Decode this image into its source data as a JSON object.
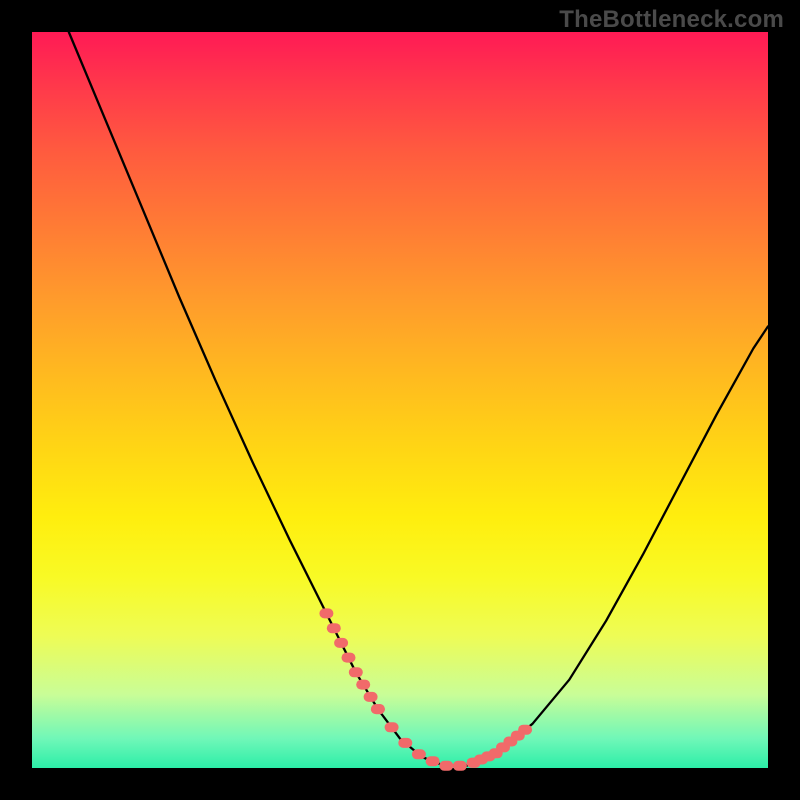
{
  "watermark": "TheBottleneck.com",
  "chart_data": {
    "type": "line",
    "title": "",
    "xlabel": "",
    "ylabel": "",
    "xlim": [
      0,
      100
    ],
    "ylim": [
      0,
      100
    ],
    "grid": false,
    "series": [
      {
        "name": "curve",
        "x": [
          5,
          10,
          15,
          20,
          25,
          30,
          35,
          40,
          44,
          47,
          50,
          53,
          56,
          59,
          63,
          68,
          73,
          78,
          83,
          88,
          93,
          98,
          100
        ],
        "y": [
          100,
          88,
          76,
          64,
          52.5,
          41.5,
          31,
          21,
          13,
          8,
          4,
          1.5,
          0.3,
          0.3,
          2,
          6,
          12,
          20,
          29,
          38.5,
          48,
          57,
          60
        ]
      }
    ],
    "paint_bands": [
      {
        "name": "left-band",
        "x_range": [
          40,
          47
        ],
        "y_range": [
          5,
          22
        ],
        "color": "#f16a6a"
      },
      {
        "name": "floor-band",
        "x_range": [
          47,
          60
        ],
        "y_range": [
          0.3,
          4
        ],
        "color": "#f16a6a"
      },
      {
        "name": "right-band",
        "x_range": [
          60,
          67
        ],
        "y_range": [
          2,
          10
        ],
        "color": "#f16a6a"
      }
    ],
    "colors": {
      "curve_stroke": "#000000",
      "paint_stroke": "#f16a6a",
      "frame_bg": "#000000"
    }
  }
}
